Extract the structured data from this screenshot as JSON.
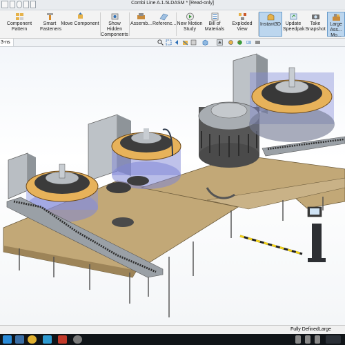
{
  "window": {
    "title": "Combi Line A.1.5LDASM * [Read-only]"
  },
  "ribbon": {
    "items": [
      {
        "label_1": "Component Pattern",
        "label_2": ""
      },
      {
        "label_1": "Smart",
        "label_2": "Fasteners"
      },
      {
        "label_1": "Move Component",
        "label_2": ""
      },
      {
        "label_1": "Show Hidden",
        "label_2": "Components"
      },
      {
        "label_1": "Assemb...",
        "label_2": ""
      },
      {
        "label_1": "Referenc...",
        "label_2": ""
      },
      {
        "label_1": "New Motion",
        "label_2": "Study"
      },
      {
        "label_1": "Bill of",
        "label_2": "Materials"
      },
      {
        "label_1": "Exploded View",
        "label_2": ""
      },
      {
        "label_1": "Instant3D",
        "label_2": ""
      },
      {
        "label_1": "Update",
        "label_2": "Speedpak"
      },
      {
        "label_1": "Take",
        "label_2": "Snapshot"
      },
      {
        "label_1": "Large Ass...",
        "label_2": "Mo..."
      }
    ]
  },
  "doc_tab": {
    "label": "3-ns"
  },
  "status": {
    "left": "Fully Defined",
    "right": "Large Asse..."
  },
  "colors": {
    "accent": "#2c6fb7",
    "active_button": "#bcd6ee",
    "platform": "#c2a877",
    "frame": "#9aa0a6"
  }
}
